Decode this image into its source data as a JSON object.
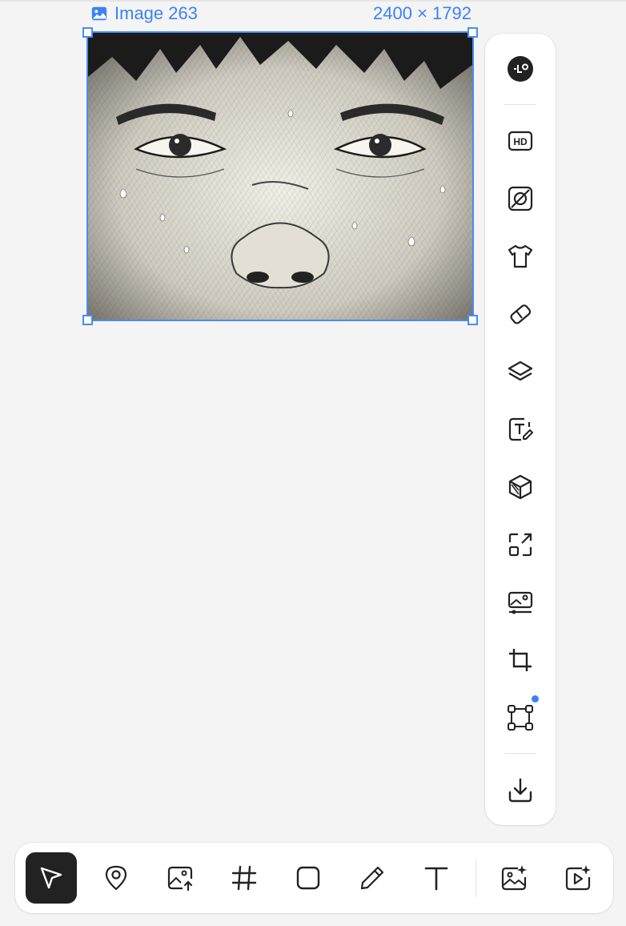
{
  "canvas": {
    "image_name": "Image 263",
    "image_dimensions": "2400 × 1792",
    "image_icon": "image-icon"
  },
  "side_toolbar": {
    "items": [
      {
        "name": "logo-avatar-button",
        "icon": "logo-icon"
      },
      {
        "name": "hd-upscale-button",
        "icon": "hd-icon"
      },
      {
        "name": "remove-background-button",
        "icon": "remove-background-icon"
      },
      {
        "name": "outfit-button",
        "icon": "tshirt-icon"
      },
      {
        "name": "eraser-button",
        "icon": "eraser-icon"
      },
      {
        "name": "layers-button",
        "icon": "layers-icon"
      },
      {
        "name": "edit-text-button",
        "icon": "text-edit-icon"
      },
      {
        "name": "3d-button",
        "icon": "cube-icon"
      },
      {
        "name": "expand-button",
        "icon": "expand-icon"
      },
      {
        "name": "adjust-image-button",
        "icon": "image-adjust-icon"
      },
      {
        "name": "crop-button",
        "icon": "crop-icon"
      },
      {
        "name": "transform-button",
        "icon": "transform-icon",
        "has_dot": true
      },
      {
        "name": "download-button",
        "icon": "download-icon"
      }
    ]
  },
  "bottom_toolbar": {
    "items": [
      {
        "name": "select-tool",
        "icon": "cursor-icon",
        "active": true
      },
      {
        "name": "marker-tool",
        "icon": "map-pin-icon"
      },
      {
        "name": "upload-image-tool",
        "icon": "image-upload-icon"
      },
      {
        "name": "frame-tool",
        "icon": "hash-icon"
      },
      {
        "name": "shape-tool",
        "icon": "square-icon"
      },
      {
        "name": "pen-tool",
        "icon": "pencil-icon"
      },
      {
        "name": "text-tool",
        "icon": "text-icon"
      },
      {
        "name": "ai-image-tool",
        "icon": "image-sparkle-icon"
      },
      {
        "name": "ai-video-tool",
        "icon": "video-sparkle-icon"
      }
    ]
  },
  "colors": {
    "accent": "#3b82f6",
    "active_tool_bg": "#222222"
  }
}
